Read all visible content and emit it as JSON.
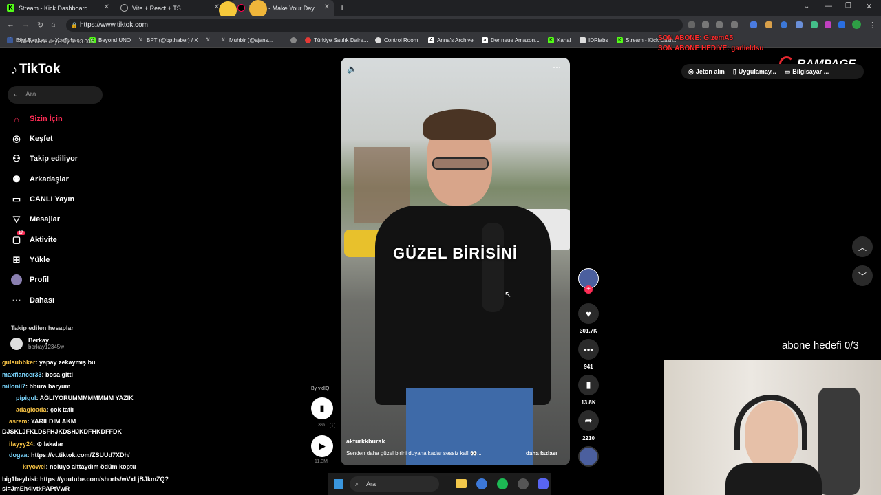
{
  "browser": {
    "tabs": [
      {
        "label": "Stream - Kick Dashboard"
      },
      {
        "label": "Vite + React + TS"
      },
      {
        "label": "TikTok - Make Your Day"
      }
    ],
    "url": "https://www.tiktok.com",
    "bookmarks": [
      {
        "label": "Bilgi Bankası"
      },
      {
        "label": "YouTube"
      },
      {
        "label": "Beyond UNO"
      },
      {
        "label": "BPT (@bpthaber) / X"
      },
      {
        "label": "Muhbir (@ajans..."
      },
      {
        "label": "Türkiye Satılık Daire..."
      },
      {
        "label": "Control Room"
      },
      {
        "label": "Anna's Archive"
      },
      {
        "label": "Der neue Amazon..."
      },
      {
        "label": "Kanal"
      },
      {
        "label": "IDRlabs"
      },
      {
        "label": "Stream - Kick Dash..."
      }
    ]
  },
  "stream_overlay": {
    "last_sub": "SON ABONE: GizemA5",
    "last_gift": "SON ABONE HEDİYE: garlieldsu",
    "brand": "RAMPAGE",
    "sub_goal": "abone hedefi 0/3",
    "ticker": "20 abonede dayı büyük 93.005"
  },
  "tiktok": {
    "logo": "TikTok",
    "search_placeholder": "Ara",
    "nav": [
      {
        "label": "Sizin İçin"
      },
      {
        "label": "Keşfet"
      },
      {
        "label": "Takip ediliyor"
      },
      {
        "label": "Arkadaşlar"
      },
      {
        "label": "CANLI Yayın"
      },
      {
        "label": "Mesajlar"
      },
      {
        "label": "Aktivite",
        "badge": "17"
      },
      {
        "label": "Yükle"
      },
      {
        "label": "Profil"
      },
      {
        "label": "Dahası"
      }
    ],
    "followed_title": "Takip edilen hesaplar",
    "followed": [
      {
        "name": "Berkay",
        "handle": "berkay12345w"
      }
    ],
    "header": {
      "coins": "Jeton alın",
      "app": "Uygulamay...",
      "pc": "Bilgisayar ..."
    },
    "video": {
      "caption_big": "GÜZEL BİRİSİNİ",
      "author": "akturkkburak",
      "description": "Senden daha güzel birini duyana kadar sessiz kal! 👀...",
      "more": "daha fazlası",
      "likes": "301.7K",
      "comments": "941",
      "saves": "13.8K",
      "shares": "2210"
    },
    "vidiq": {
      "label": "By vidIQ",
      "percent": "3%",
      "views": "11.3M"
    }
  },
  "chat": [
    {
      "user": "gulsubbker",
      "msg": ": yapay zekaymış bu"
    },
    {
      "user": "maxflancer33",
      "msg": ": bosa gitti"
    },
    {
      "user": "milonii7",
      "msg": ": bbura baryum"
    },
    {
      "user": "pipigul",
      "msg": ": AĞLIYORUMMMMMMMM YAZIK"
    },
    {
      "user": "adagioada",
      "msg": ": çok tatlı"
    },
    {
      "user": "asrem",
      "msg": ": YARILDIM AKM"
    },
    {
      "user": "",
      "msg": "DJSKLJFKLDSFHJKDSHJKDFHKDFFDK"
    },
    {
      "user": "ilayyy24",
      "msg": ": ⊙ lakalar"
    },
    {
      "user": "dogaa",
      "msg": ": https://vt.tiktok.com/ZSUUd7XDh/"
    },
    {
      "user": "kryowei",
      "msg": ": noluyo alttaydım ödüm koptu"
    },
    {
      "user": "big1beybisi",
      "msg": ": https://youtube.com/shorts/wVxLjBJkmZQ?si=JmEh4lvtkPAPtVwR"
    }
  ],
  "taskbar": {
    "search": "Ara"
  }
}
